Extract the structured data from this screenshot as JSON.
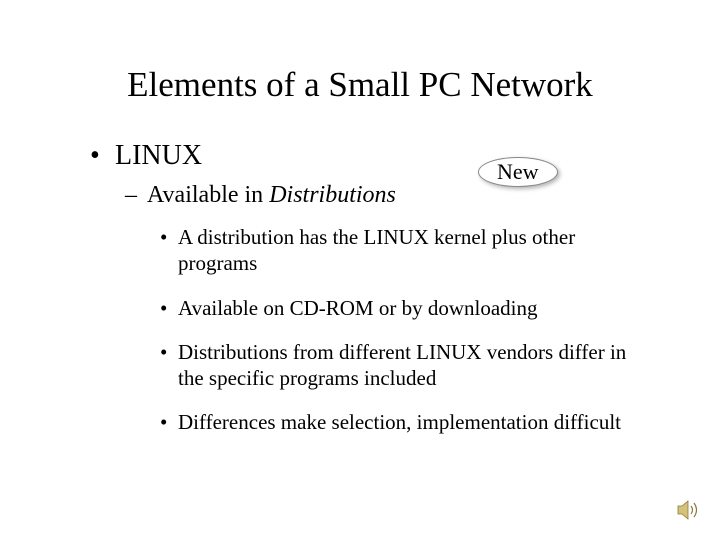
{
  "title": "Elements of a Small PC Network",
  "level1": {
    "bullet": "•",
    "text": "LINUX"
  },
  "level2": {
    "dash": "–",
    "text_prefix": "Available in ",
    "text_italic": "Distributions"
  },
  "callout": "New",
  "level3": [
    {
      "bullet": "•",
      "text": "A distribution has the LINUX kernel plus other programs"
    },
    {
      "bullet": "•",
      "text": "Available on CD-ROM or by downloading"
    },
    {
      "bullet": "•",
      "text": "Distributions from different LINUX vendors differ in the specific programs included"
    },
    {
      "bullet": "•",
      "text": "Differences make selection, implementation difficult"
    }
  ]
}
